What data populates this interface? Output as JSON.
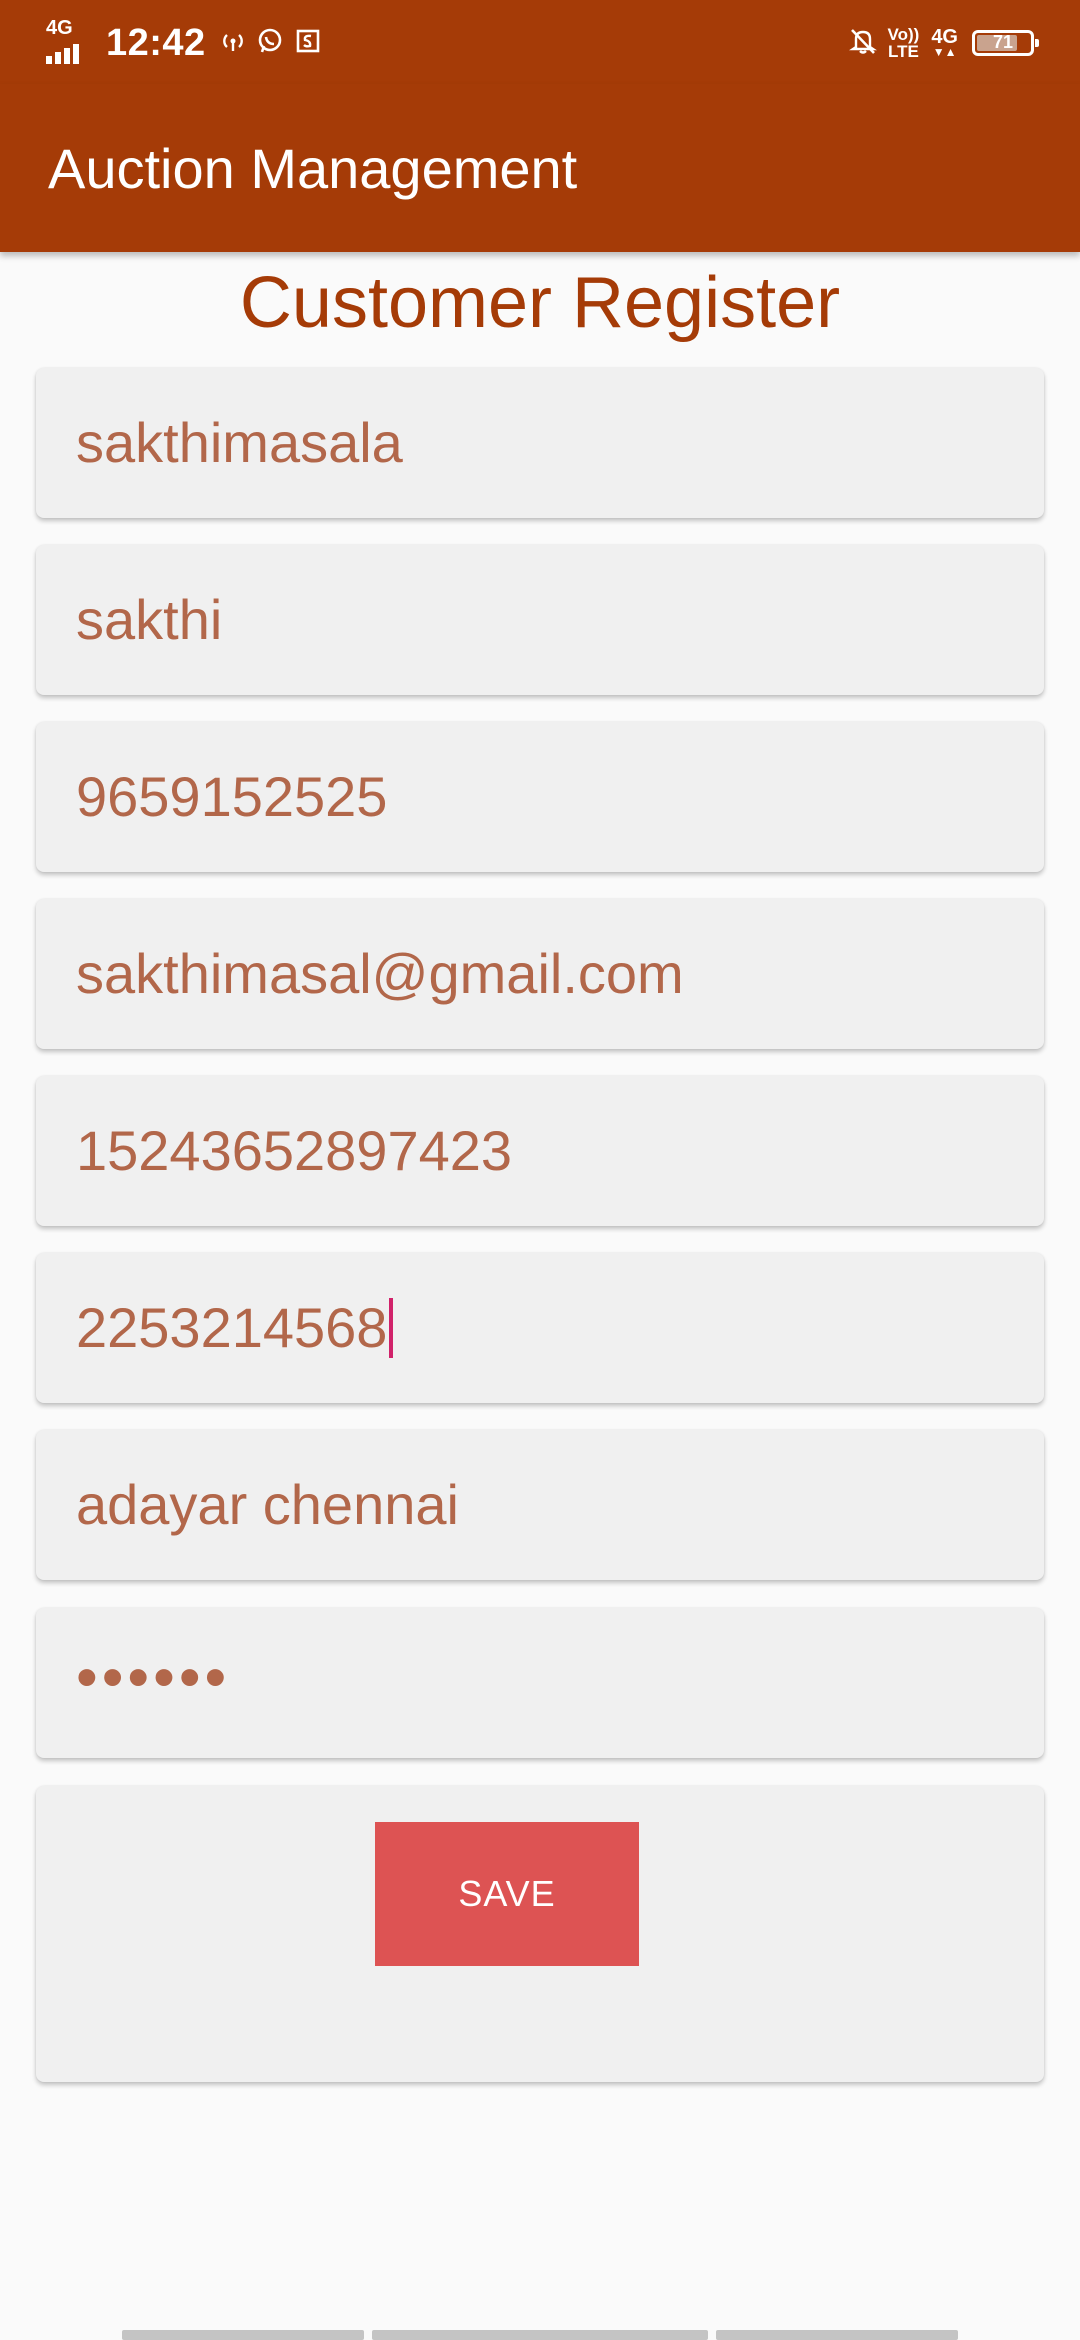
{
  "status_bar": {
    "network_type": "4G",
    "time": "12:42",
    "volte_top": "Vo))",
    "volte_bottom": "LTE",
    "network_right": "4G",
    "battery_level": "71",
    "icons": [
      "hotspot-icon",
      "whatsapp-icon",
      "screenshot-icon",
      "notifications-off-icon"
    ]
  },
  "app_bar": {
    "title": "Auction Management",
    "color": "#a53b07"
  },
  "page": {
    "heading": "Customer Register"
  },
  "form": {
    "fields": [
      {
        "name": "company-name-field",
        "value": "sakthimasala"
      },
      {
        "name": "customer-name-field",
        "value": "sakthi"
      },
      {
        "name": "phone-field",
        "value": "9659152525"
      },
      {
        "name": "email-field",
        "value": "sakthimasal@gmail.com"
      },
      {
        "name": "account-number-field",
        "value": "15243652897423"
      },
      {
        "name": "id-number-field",
        "value": "2253214568"
      },
      {
        "name": "address-field",
        "value": "adayar chennai"
      },
      {
        "name": "password-field",
        "value": "••••••"
      }
    ],
    "focused_field": "id-number-field",
    "save_label": "SAVE",
    "save_color": "#dd5353"
  }
}
